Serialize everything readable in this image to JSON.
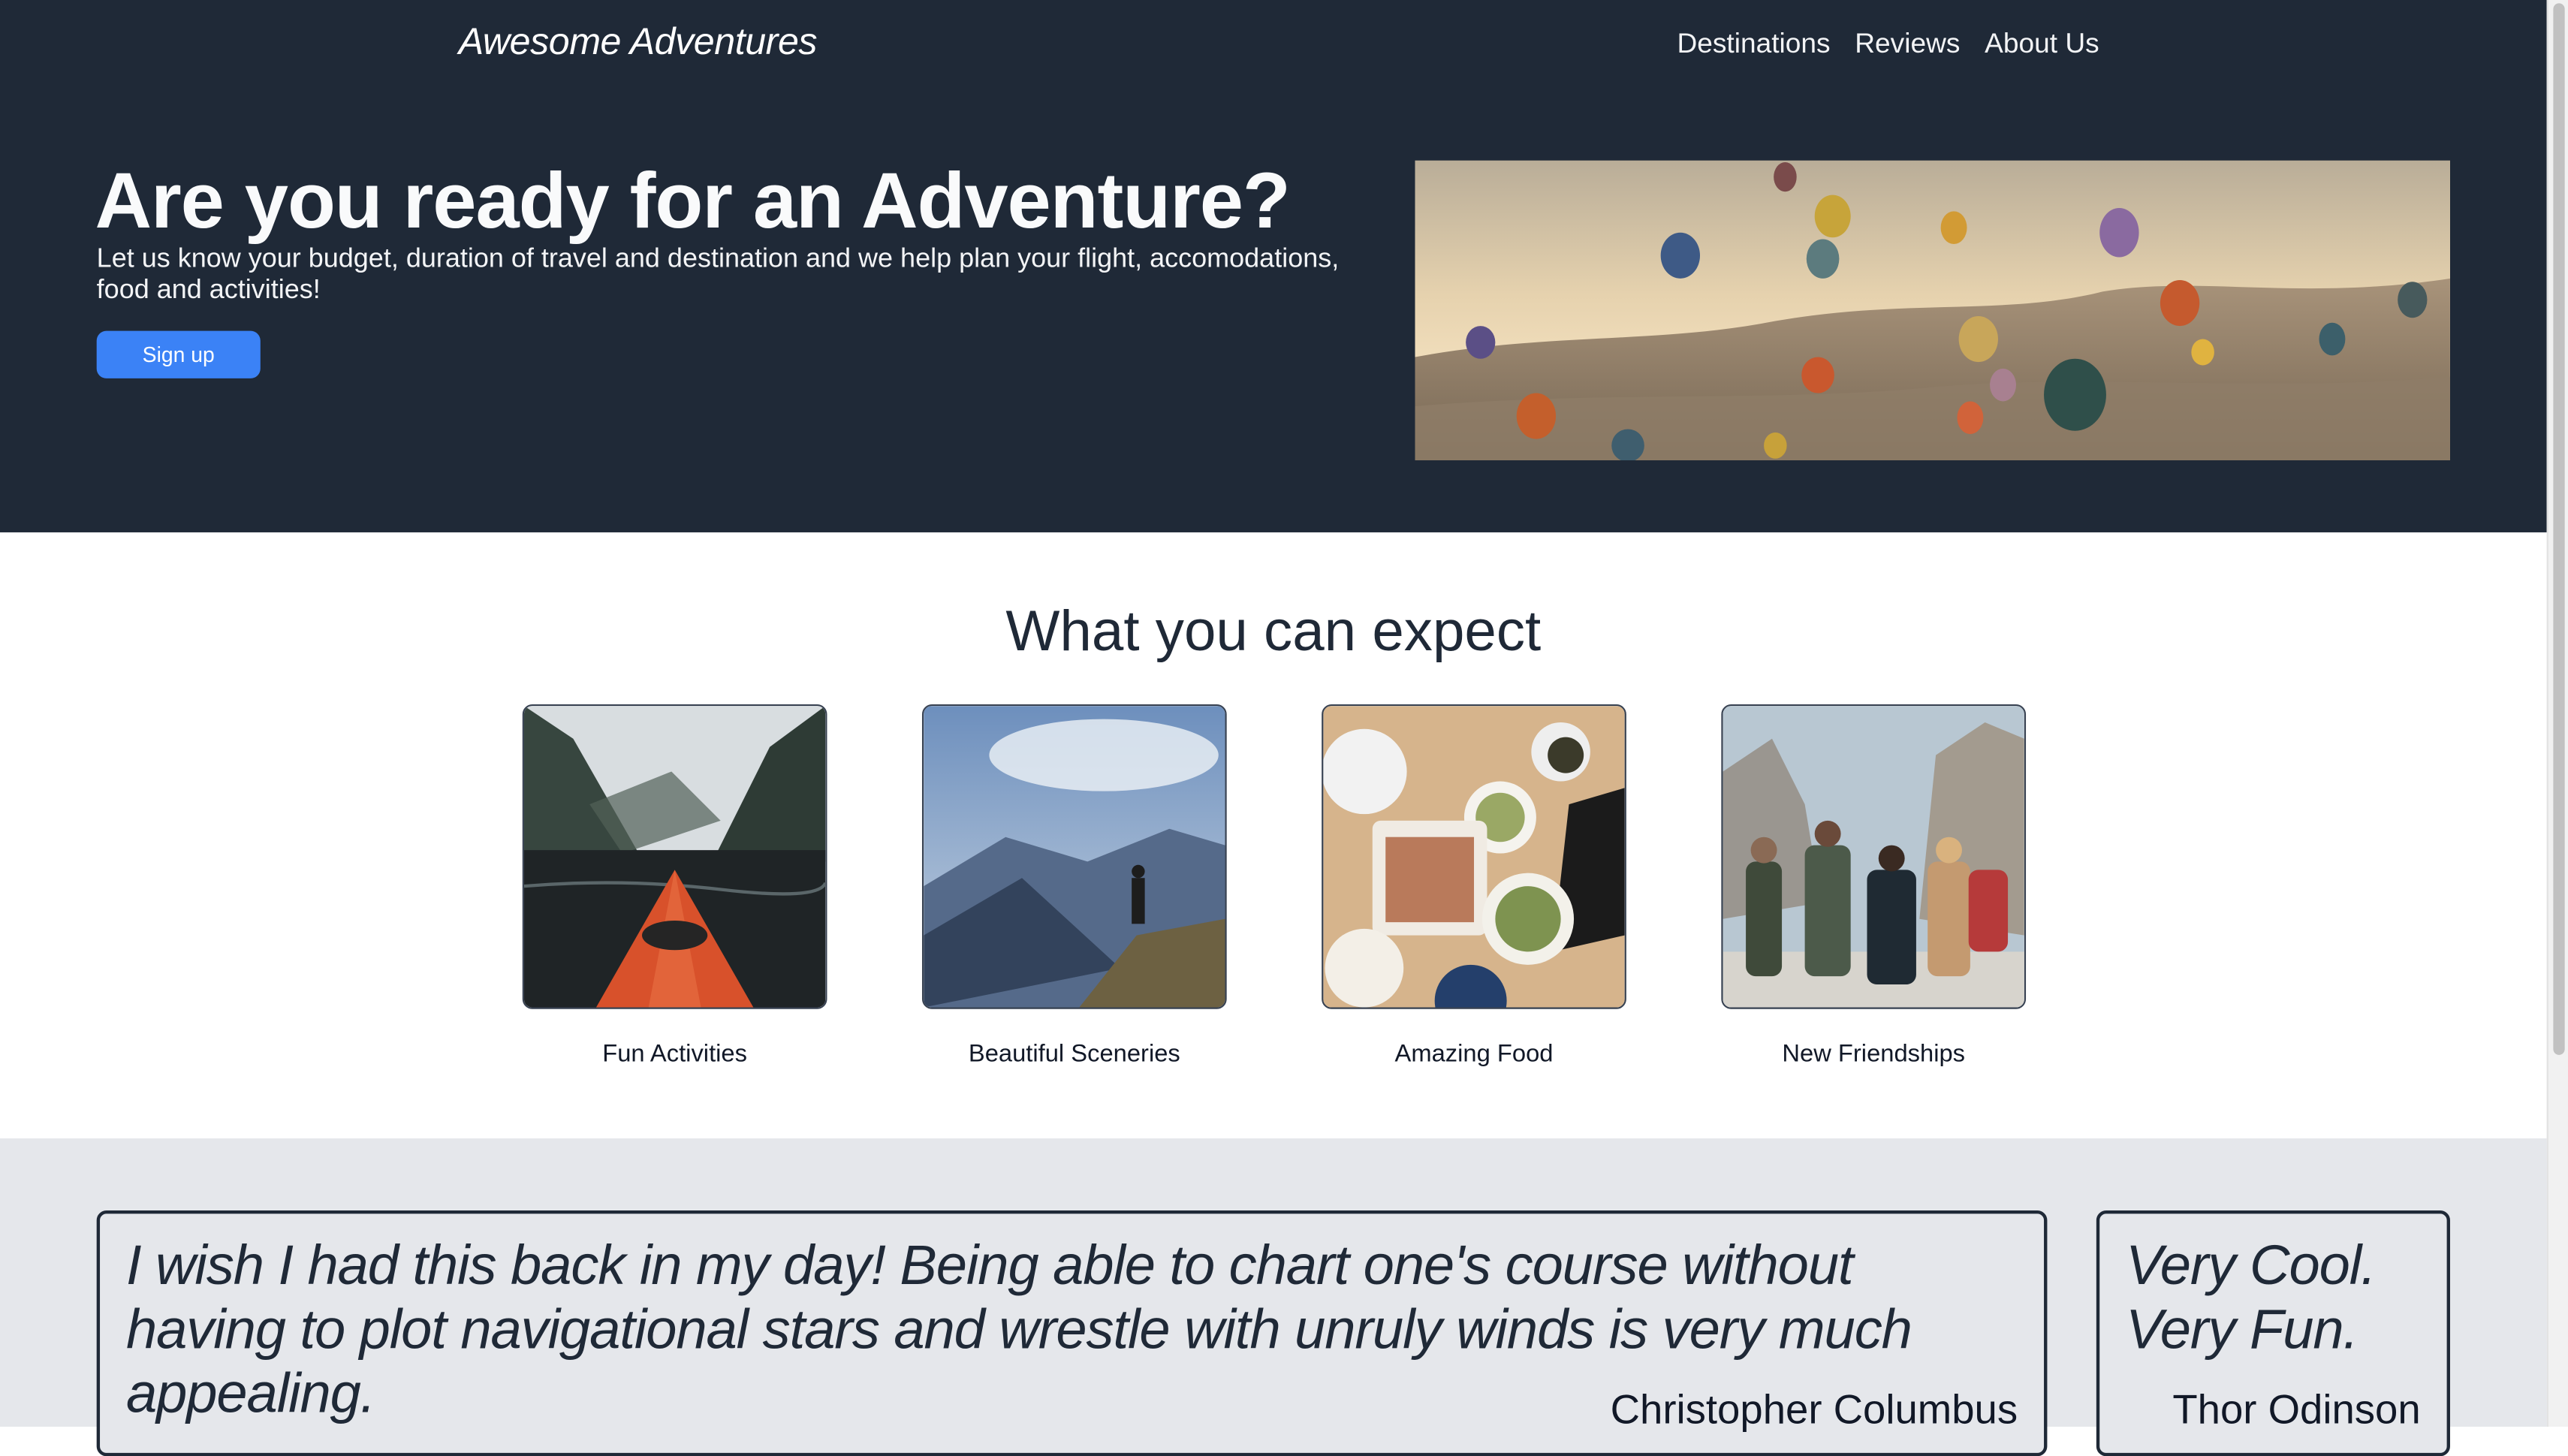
{
  "header": {
    "brand": "Awesome Adventures",
    "nav": [
      "Destinations",
      "Reviews",
      "About Us"
    ]
  },
  "hero": {
    "title": "Are you ready for an Adventure?",
    "subtitle": "Let us know your budget, duration of travel and destination and we help plan your flight, accomodations, food and activities!",
    "signup_label": "Sign up",
    "image_icon": "hot-air-balloons-image"
  },
  "expect": {
    "title": "What you can expect",
    "items": [
      {
        "label": "Fun Activities",
        "icon": "kayak-image"
      },
      {
        "label": "Beautiful Sceneries",
        "icon": "mountain-hiker-image"
      },
      {
        "label": "Amazing Food",
        "icon": "food-table-image"
      },
      {
        "label": "New Friendships",
        "icon": "friends-group-image"
      }
    ]
  },
  "reviews": [
    {
      "quote": "I wish I had this back in my day! Being able to chart one's course without having to plot navigational stars and wrestle with unruly winds is very much appealing.",
      "author": "Christopher Columbus"
    },
    {
      "quote": "Very Cool. Very Fun.",
      "author": "Thor Odinson"
    }
  ],
  "colors": {
    "header_bg": "#1f2937",
    "accent": "#3b82f6",
    "reviews_bg": "#e5e7eb"
  }
}
